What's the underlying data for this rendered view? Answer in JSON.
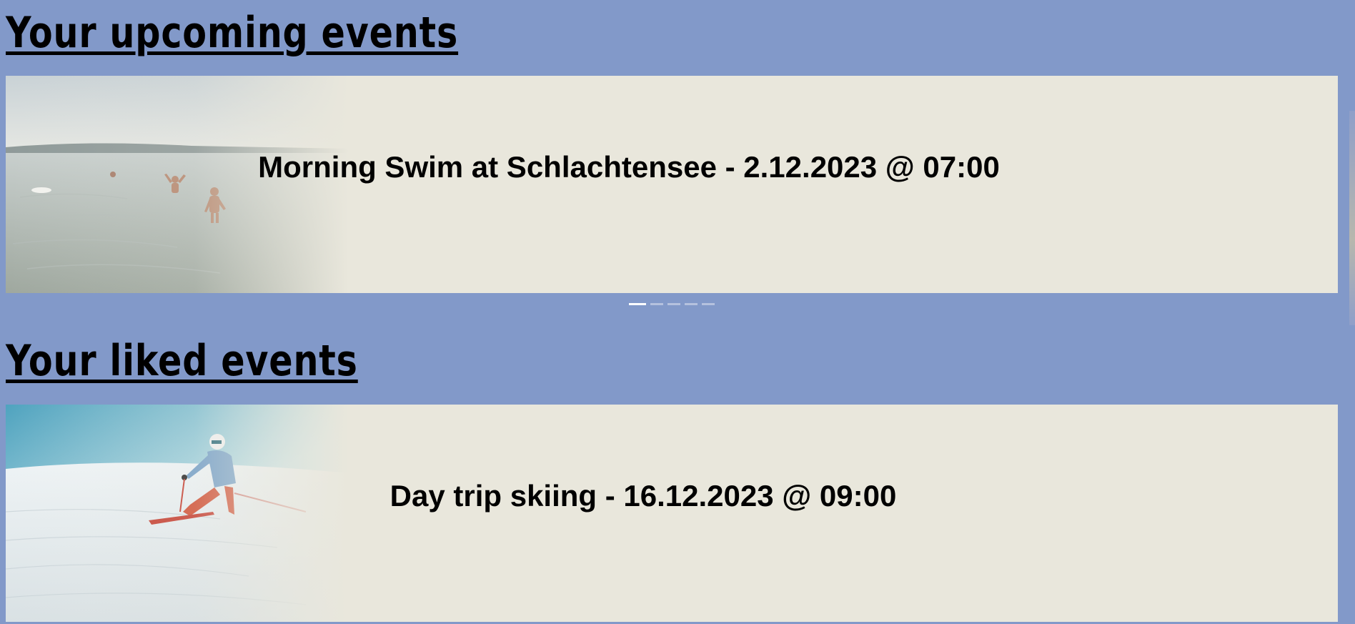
{
  "sections": {
    "upcoming": {
      "title": "Your upcoming events",
      "event_text": "Morning Swim at Schlachtensee - 2.12.2023 @ 07:00",
      "image": "lake-swimmers-photo",
      "indicators": [
        {
          "active": true
        },
        {
          "active": false
        },
        {
          "active": false
        },
        {
          "active": false
        },
        {
          "active": false
        }
      ]
    },
    "liked": {
      "title": "Your liked events",
      "event_text": "Day trip skiing - 16.12.2023 @ 09:00",
      "image": "skier-on-slope-photo"
    }
  },
  "colors": {
    "page_background": "#8299c9",
    "card_background": "#e9e7dc",
    "text": "#000000",
    "indicator_active": "#ffffff",
    "indicator_inactive": "#c2cbe4"
  }
}
